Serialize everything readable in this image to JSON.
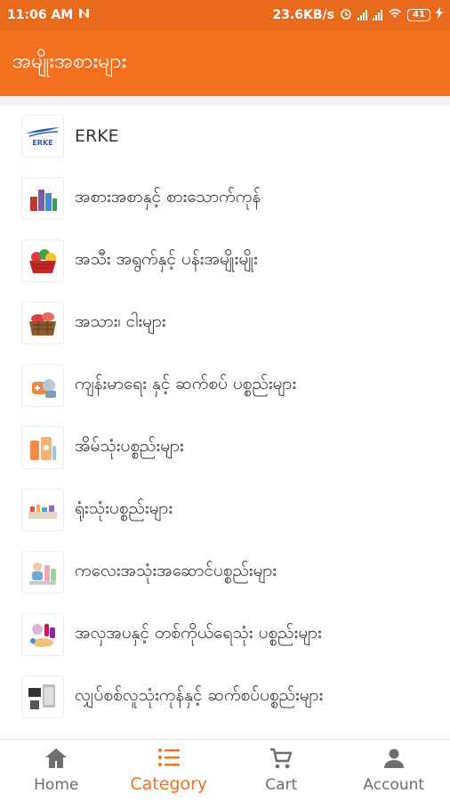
{
  "status_bar": {
    "time": "11:06 AM",
    "speed": "23.6KB/s",
    "battery": "41",
    "icons": [
      "notification-icon",
      "alarm-icon",
      "signal-icon",
      "wifi-icon",
      "battery-icon",
      "charging-icon"
    ]
  },
  "header": {
    "title": "အမျိုးအစားများ"
  },
  "categories": [
    {
      "label": "ERKE",
      "icon": "erke-logo"
    },
    {
      "label": "အစားအစာနှင့် စားသောက်ကုန်",
      "icon": "groceries-image"
    },
    {
      "label": "အသီး အရွက်နှင့် ပန်းအမျိုးမျိုး",
      "icon": "fruit-basket-image"
    },
    {
      "label": "အသား၊ ငါးများ",
      "icon": "meat-basket-image"
    },
    {
      "label": "ကျန်းမာရေး နှင့် ဆက်စပ် ပစ္စည်းများ",
      "icon": "health-products-image"
    },
    {
      "label": "အိမ်သုံးပစ္စည်းများ",
      "icon": "household-image"
    },
    {
      "label": "ရုံးသုံးပစ္စည်းများ",
      "icon": "office-supplies-image"
    },
    {
      "label": "ကလေးအသုံးအဆောင်ပစ္စည်းများ",
      "icon": "baby-products-image"
    },
    {
      "label": "အလှအပနှင့် တစ်ကိုယ်ရေသုံး ပစ္စည်းများ",
      "icon": "cosmetics-image"
    },
    {
      "label": "လျှပ်စစ်လူသုံးကုန်နှင့် ဆက်စပ်ပစ္စည်းများ",
      "icon": "electronics-image"
    }
  ],
  "bottom_nav": {
    "active": "Category",
    "items": [
      {
        "label": "Home",
        "icon": "home-icon"
      },
      {
        "label": "Category",
        "icon": "list-icon"
      },
      {
        "label": "Cart",
        "icon": "cart-icon"
      },
      {
        "label": "Account",
        "icon": "account-icon"
      }
    ]
  },
  "colors": {
    "accent": "#f37021",
    "status_bar": "#e96a1d",
    "inactive": "#6e6e6e",
    "background": "#f3f3f3"
  }
}
